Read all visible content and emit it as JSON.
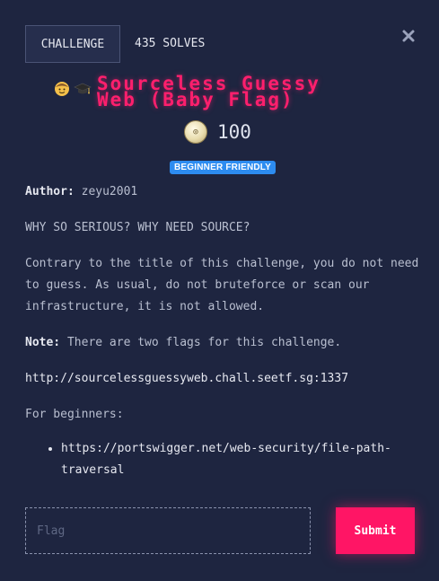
{
  "header": {
    "tab_label": "CHALLENGE",
    "solves": "435 SOLVES"
  },
  "challenge": {
    "title": "Sourceless Guessy\nWeb (Baby Flag)",
    "icons": [
      "person-icon",
      "graduation-cap-icon"
    ],
    "points": "100",
    "badge": "BEGINNER FRIENDLY"
  },
  "description": {
    "author_label": "Author:",
    "author_value": " zeyu2001",
    "para1": "WHY SO SERIOUS? WHY NEED SOURCE?",
    "para2": "Contrary to the title of this challenge, you do not need to guess. As usual, do not bruteforce or scan our infrastructure, it is not allowed.",
    "note_label": "Note:",
    "note_value": " There are two flags for this challenge.",
    "url": "http://sourcelessguessyweb.chall.seetf.sg:1337",
    "beginners_label": "For beginners:",
    "links": [
      "https://portswigger.net/web-security/file-path-traversal"
    ]
  },
  "form": {
    "flag_placeholder": "Flag",
    "flag_value": "",
    "submit_label": "Submit"
  },
  "colors": {
    "background": "#1e2540",
    "accent": "#ff1565",
    "badge": "#2d8cf0"
  }
}
